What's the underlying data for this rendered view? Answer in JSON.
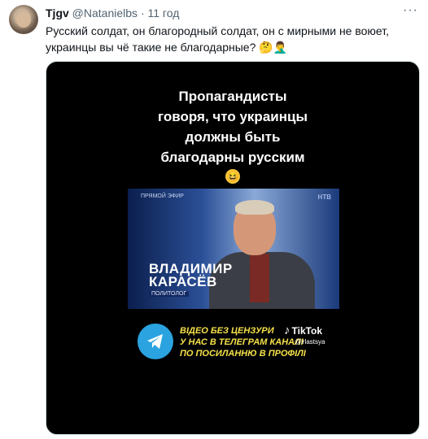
{
  "tweet": {
    "name": "Tjgv",
    "handle": "@Natanielbs",
    "separator": "·",
    "time": "11 год",
    "more_icon": "more-icon",
    "text": "Русский солдат, он благородный солдат, он с мирными не воюет, украинцы вы чё такие не благодарные?",
    "text_emojis": "🤔🤦‍♂️"
  },
  "media": {
    "caption_line1": "Пропагандисты",
    "caption_line2": "говоря, что украинцы",
    "caption_line3": "должны быть",
    "caption_line4": "благодарны русским",
    "caption_emoji": "😆",
    "video": {
      "channel": "ПРЯМОЙ ЭФИР",
      "brand": "НТВ",
      "name_line1": "ВЛАДИМИР",
      "name_line2": "КАРАСЁВ",
      "role": "ПОЛИТОЛОГ"
    },
    "promo_line1": "ВІДЕО БЕЗ ЦЕНЗУРИ",
    "promo_line2": "У НАС В ТЕЛЕГРАМ КАНАЛІ",
    "promo_line3": "ПО ПОСИЛАННЮ В ПРОФІЛІ",
    "tiktok_label": "TikTok",
    "tiktok_handle": "@irlastsya"
  }
}
